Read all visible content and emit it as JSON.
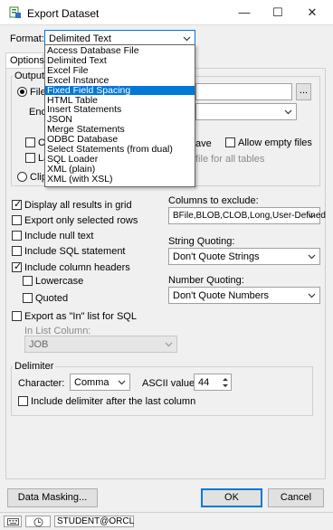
{
  "window": {
    "title": "Export Dataset",
    "minimize": "—",
    "maximize": "☐",
    "close": "✕"
  },
  "format": {
    "label": "Format:",
    "selected": "Delimited Text",
    "options": [
      "Access Database File",
      "Delimited Text",
      "Excel File",
      "Excel Instance",
      "Fixed Field Spacing",
      "HTML Table",
      "Insert Statements",
      "JSON",
      "Merge Statements",
      "ODBC Database",
      "Select Statements (from dual)",
      "SQL Loader",
      "XML (plain)",
      "XML (with XSL)"
    ],
    "highlighted_index": 4
  },
  "tabs": {
    "options": "Options"
  },
  "output": {
    "group_label": "Output",
    "file_radio_label": "File",
    "encoding_label": "Enco",
    "browse_button": "...",
    "co_label": "Co",
    "la_label": "La",
    "ave_label": "ave",
    "allow_empty_files": "Allow empty files",
    "file_for_all_tables": "file for all tables",
    "clip_label": "Clip"
  },
  "options": {
    "display_all_results": "Display all results in grid",
    "export_only_selected": "Export only selected rows",
    "include_null_text": "Include null text",
    "include_sql_statement": "Include SQL statement",
    "include_column_headers": "Include column headers",
    "lowercase": "Lowercase",
    "quoted": "Quoted",
    "export_in_list": "Export as \"In\" list for SQL",
    "in_list_column_label": "In List Column:",
    "in_list_column_value": "JOB"
  },
  "right": {
    "columns_to_exclude_label": "Columns to exclude:",
    "columns_to_exclude_value": "BFile,BLOB,CLOB,Long,User-Defined",
    "string_quoting_label": "String Quoting:",
    "string_quoting_value": "Don't Quote Strings",
    "number_quoting_label": "Number Quoting:",
    "number_quoting_value": "Don't Quote Numbers"
  },
  "delimiter": {
    "group_label": "Delimiter",
    "character_label": "Character:",
    "character_value": "Comma",
    "ascii_label": "ASCII value:",
    "ascii_value": "44",
    "include_after_last": "Include delimiter after the last column"
  },
  "buttons": {
    "data_masking": "Data Masking...",
    "ok": "OK",
    "cancel": "Cancel"
  },
  "statusbar": {
    "connection": "STUDENT@ORCL"
  },
  "colors": {
    "highlight": "#0078d7",
    "dialog_bg": "#f0f0f0"
  }
}
